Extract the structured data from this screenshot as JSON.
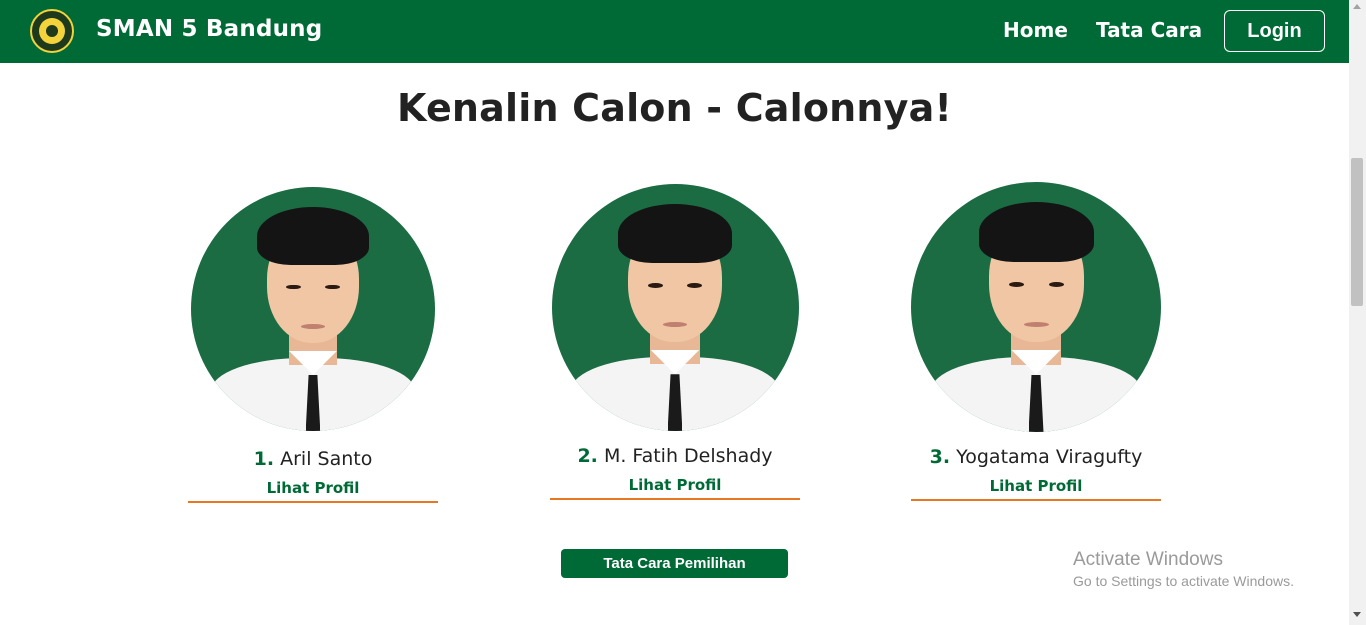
{
  "header": {
    "brand": "SMAN 5 Bandung",
    "nav": {
      "home": "Home",
      "tata_cara": "Tata Cara"
    },
    "login_label": "Login",
    "bg_color": "#006a36"
  },
  "main": {
    "heading": "Kenalin Calon - Calonnya!",
    "candidates": [
      {
        "number": "1.",
        "name": "Aril Santo",
        "link": "Lihat Profil"
      },
      {
        "number": "2.",
        "name": "M. Fatih Delshady",
        "link": "Lihat Profil"
      },
      {
        "number": "3.",
        "name": "Yogatama Viragufty",
        "link": "Lihat Profil"
      }
    ],
    "cta_label": "Tata Cara Pemilihan",
    "accent_color": "#e87722"
  },
  "watermark": {
    "title": "Activate Windows",
    "subtitle": "Go to Settings to activate Windows."
  }
}
